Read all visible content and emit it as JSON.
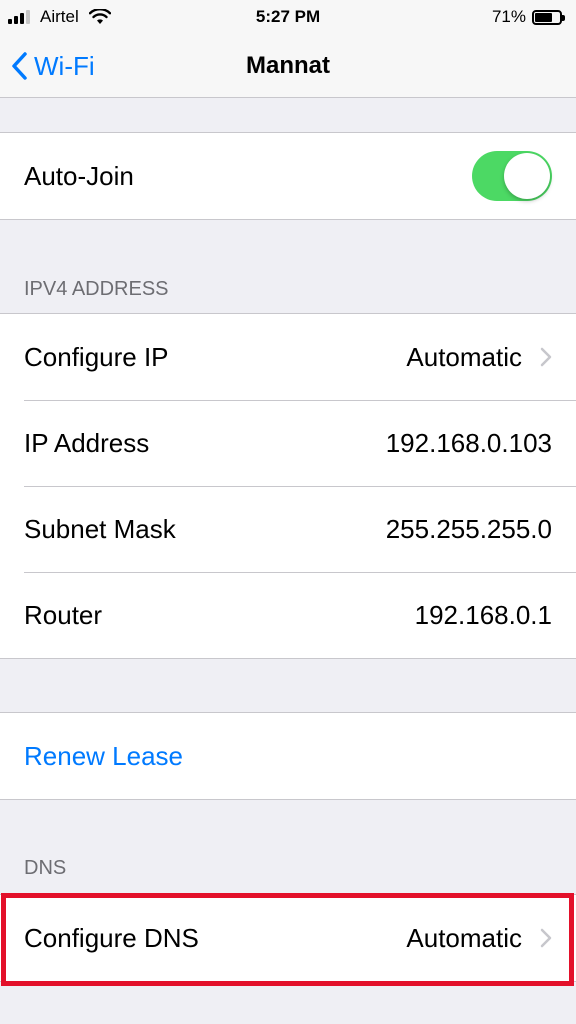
{
  "status_bar": {
    "carrier": "Airtel",
    "time": "5:27 PM",
    "battery": "71%",
    "battery_level": 0.71
  },
  "nav": {
    "back_label": "Wi-Fi",
    "title": "Mannat"
  },
  "auto_join": {
    "label": "Auto-Join",
    "enabled": true
  },
  "ipv4": {
    "header": "IPV4 ADDRESS",
    "configure_ip": {
      "label": "Configure IP",
      "value": "Automatic"
    },
    "ip_address": {
      "label": "IP Address",
      "value": "192.168.0.103"
    },
    "subnet_mask": {
      "label": "Subnet Mask",
      "value": "255.255.255.0"
    },
    "router": {
      "label": "Router",
      "value": "192.168.0.1"
    }
  },
  "renew_lease": {
    "label": "Renew Lease"
  },
  "dns": {
    "header": "DNS",
    "configure_dns": {
      "label": "Configure DNS",
      "value": "Automatic"
    }
  },
  "colors": {
    "accent": "#007aff",
    "toggle_on": "#4cd964",
    "highlight": "#e3102a",
    "background": "#efeff4"
  }
}
